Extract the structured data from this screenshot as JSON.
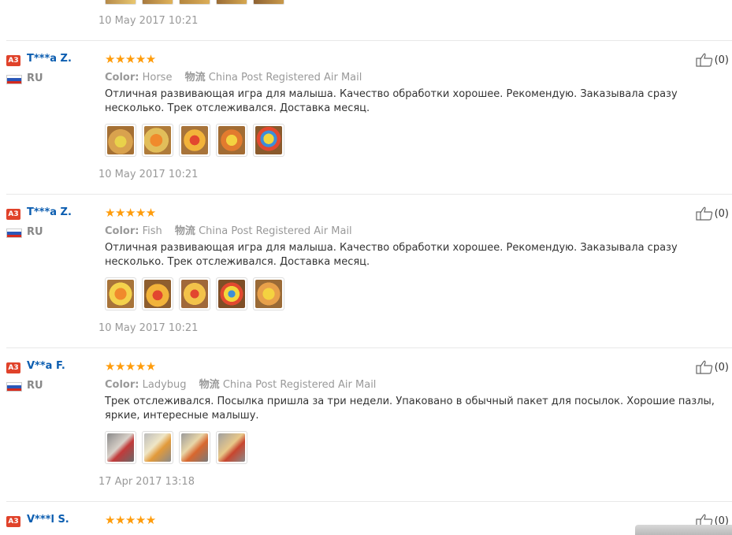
{
  "top": {
    "date": "10 May 2017 10:21",
    "thumb_count": 5
  },
  "reviews": [
    {
      "badge": "A3",
      "user": "T***a Z.",
      "country": "RU",
      "stars": "★★★★★",
      "color_label": "Color:",
      "color_value": "Horse",
      "ship_label": "物流",
      "ship_value": "China Post Registered Air Mail",
      "text": "Отличная развивающая игра для малыша. Качество обработки хорошее. Рекомендую. Заказывала сразу несколько. Трек отслеживался. Доставка месяц.",
      "likes": "(0)",
      "date": "10 May 2017 10:21"
    },
    {
      "badge": "A3",
      "user": "T***a Z.",
      "country": "RU",
      "stars": "★★★★★",
      "color_label": "Color:",
      "color_value": "Fish",
      "ship_label": "物流",
      "ship_value": "China Post Registered Air Mail",
      "text": "Отличная развивающая игра для малыша. Качество обработки хорошее. Рекомендую. Заказывала сразу несколько. Трек отслеживался. Доставка месяц.",
      "likes": "(0)",
      "date": "10 May 2017 10:21"
    },
    {
      "badge": "A3",
      "user": "V**a F.",
      "country": "RU",
      "stars": "★★★★★",
      "color_label": "Color:",
      "color_value": "Ladybug",
      "ship_label": "物流",
      "ship_value": "China Post Registered Air Mail",
      "text": "Трек отслеживался. Посылка пришла за три недели. Упаковано в обычный пакет для посылок. Хорошие пазлы, яркие, интересные малышу.",
      "likes": "(0)",
      "date": "17 Apr 2017 13:18"
    },
    {
      "badge": "A3",
      "user": "V***l S.",
      "country": "",
      "stars": "★★★★★",
      "likes": "(0)"
    }
  ],
  "colors": {
    "star": "#ff9c0b",
    "username": "#0b5db0",
    "badge": "#e0422a",
    "muted": "#999999"
  }
}
